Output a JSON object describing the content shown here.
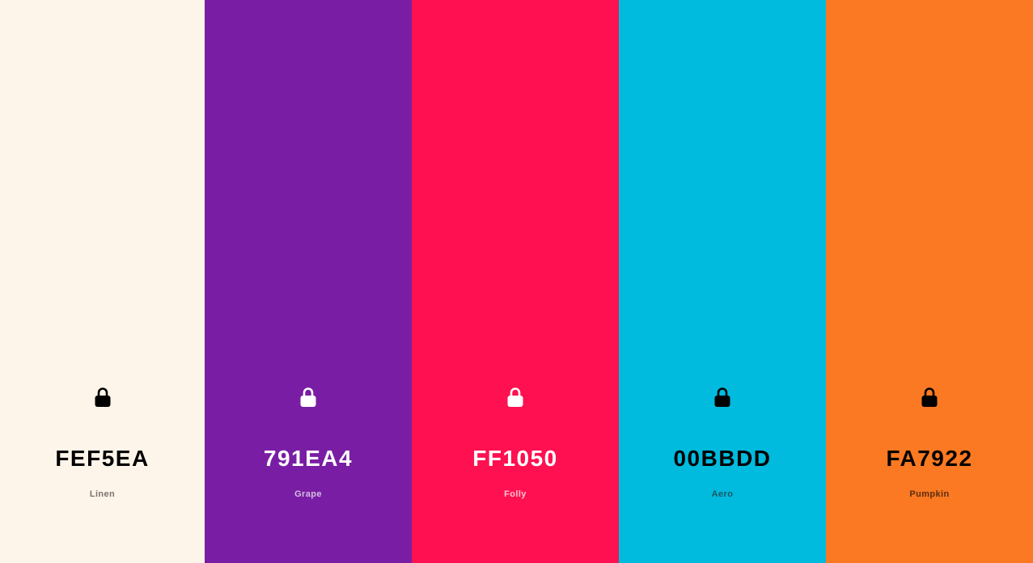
{
  "palette": [
    {
      "hex": "FEF5EA",
      "name": "Linen",
      "bg": "#FEF5EA",
      "fg": "#000000",
      "sub": "#7a746e",
      "lock_color": "#000000",
      "icon": "lock-icon"
    },
    {
      "hex": "791EA4",
      "name": "Grape",
      "bg": "#791EA4",
      "fg": "#FFFFFF",
      "sub": "#d7bde4",
      "lock_color": "#FFFFFF",
      "icon": "lock-icon"
    },
    {
      "hex": "FF1050",
      "name": "Folly",
      "bg": "#FF1050",
      "fg": "#FFFFFF",
      "sub": "#ffc3d2",
      "lock_color": "#FFFFFF",
      "icon": "lock-icon"
    },
    {
      "hex": "00BBDD",
      "name": "Aero",
      "bg": "#00BBDD",
      "fg": "#000000",
      "sub": "#1d5563",
      "lock_color": "#000000",
      "icon": "lock-icon"
    },
    {
      "hex": "FA7922",
      "name": "Pumpkin",
      "bg": "#FA7922",
      "fg": "#000000",
      "sub": "#5b2e10",
      "lock_color": "#000000",
      "icon": "lock-icon"
    }
  ]
}
